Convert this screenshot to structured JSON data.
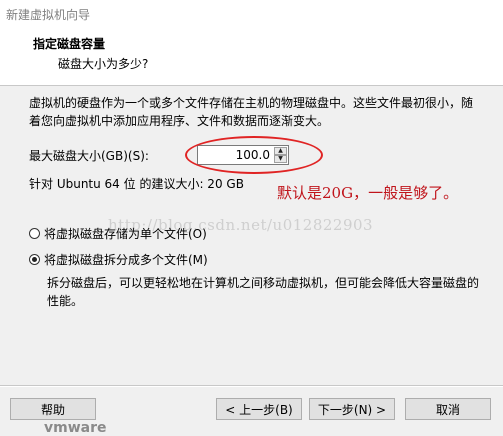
{
  "window": {
    "title": "新建虚拟机向导"
  },
  "header": {
    "title": "指定磁盘容量",
    "subtitle": "磁盘大小为多少?"
  },
  "description": "虚拟机的硬盘作为一个或多个文件存储在主机的物理磁盘中。这些文件最初很小，随着您向虚拟机中添加应用程序、文件和数据而逐渐变大。",
  "disk_size": {
    "label": "最大磁盘大小(GB)(S):",
    "value": "100.0",
    "recommend": "针对 Ubuntu 64 位 的建议大小: 20 GB"
  },
  "annotation": {
    "text": "默认是20G，一般是够了。",
    "color": "#c0141b",
    "ellipse_color": "#e02424"
  },
  "watermark": "http://blog.csdn.net/u012822903",
  "options": {
    "single_file": "将虚拟磁盘存储为单个文件(O)",
    "multi_file": "将虚拟磁盘拆分成多个文件(M)",
    "selected": "multi_file",
    "multi_description": "拆分磁盘后，可以更轻松地在计算机之间移动虚拟机，但可能会降低大容量磁盘的性能。"
  },
  "buttons": {
    "help": "帮助",
    "back": "< 上一步(B)",
    "next": "下一步(N) >",
    "cancel": "取消"
  },
  "background_text": "vmware"
}
